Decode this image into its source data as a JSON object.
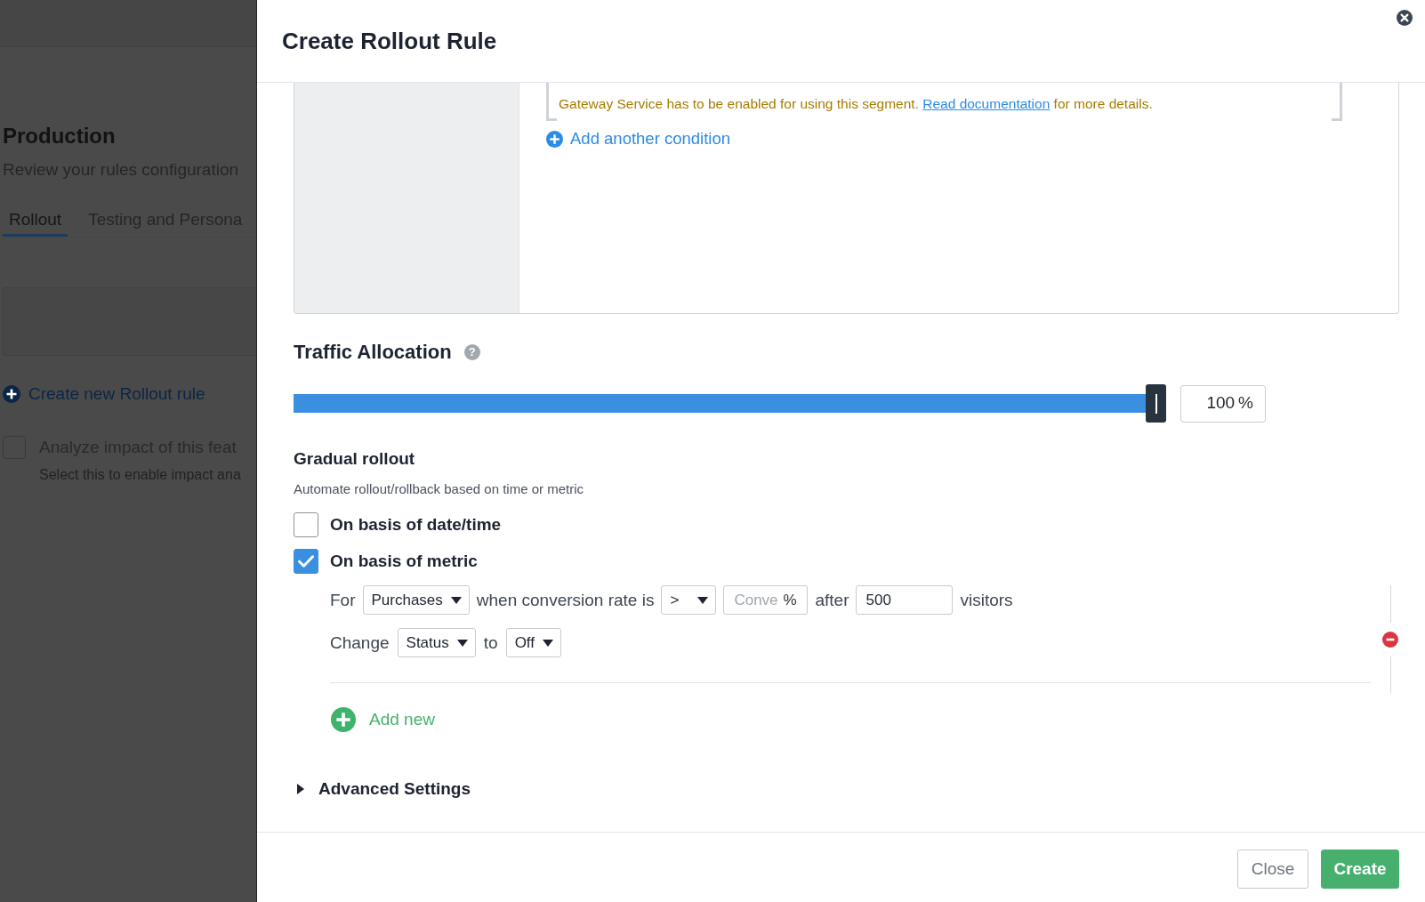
{
  "backdrop": {
    "heading": "Production",
    "subtitle": "Review your rules configuration",
    "tabs": [
      {
        "label": "Rollout",
        "selected": true
      },
      {
        "label": "Testing and Persona",
        "selected": false
      }
    ],
    "create_link": "Create new Rollout rule",
    "analyze_option": {
      "label": "Analyze impact of this feat",
      "hint": "Select this to enable impact ana",
      "checked": false
    }
  },
  "dialog": {
    "title": "Create Rollout Rule",
    "segment": {
      "warning": {
        "before": "Gateway Service has to be enabled for using this segment. ",
        "link": "Read documentation",
        "after": " for more details."
      },
      "add_condition": "Add another condition"
    },
    "traffic_allocation": {
      "title": "Traffic Allocation",
      "help": "?",
      "level": 1,
      "value": "100",
      "unit": "%"
    },
    "gradual_rollout": {
      "title": "Gradual rollout",
      "description": "Automate rollout/rollback based on time or metric",
      "options": [
        {
          "label": "On basis of date/time",
          "checked": false
        },
        {
          "label": "On basis of metric",
          "checked": true
        }
      ]
    },
    "metric_rule": {
      "rows": [
        {
          "parts": [
            {
              "kind": "text",
              "text": "For"
            },
            {
              "kind": "select",
              "value": "Purchases"
            },
            {
              "kind": "text",
              "text": "when conversion rate is"
            },
            {
              "kind": "select",
              "value": ">"
            },
            {
              "kind": "input",
              "placeholder": "Conve",
              "unit": "%"
            },
            {
              "kind": "text",
              "text": "after"
            },
            {
              "kind": "input",
              "value": "500"
            },
            {
              "kind": "text",
              "text": "visitors"
            }
          ]
        },
        {
          "parts": [
            {
              "kind": "text",
              "text": "Change"
            },
            {
              "kind": "select",
              "value": "Status"
            },
            {
              "kind": "text",
              "text": "to"
            },
            {
              "kind": "select",
              "value": "Off"
            }
          ]
        }
      ]
    },
    "add_new": "Add new",
    "advanced_settings": {
      "label": "Advanced Settings",
      "expanded": false
    },
    "footer": {
      "buttons": [
        {
          "label": "Close",
          "kind": "secondary"
        },
        {
          "label": "Create",
          "kind": "primary"
        }
      ]
    }
  }
}
